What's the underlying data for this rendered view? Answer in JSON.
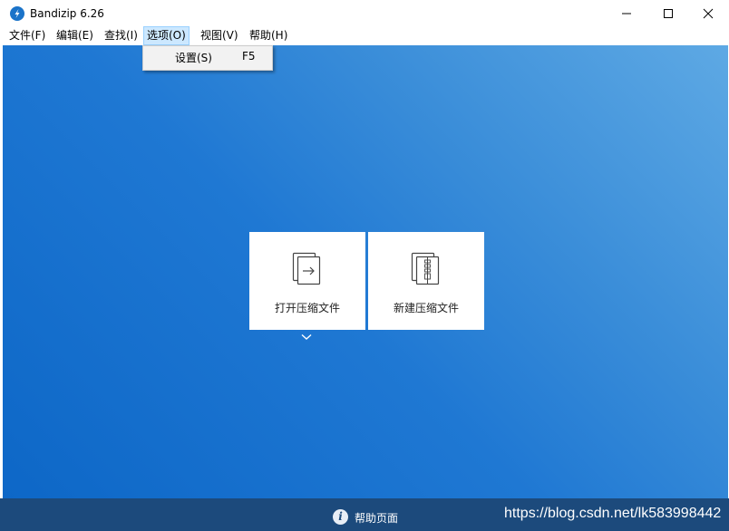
{
  "window": {
    "title": "Bandizip 6.26",
    "icon": "bandizip-logo-icon",
    "controls": [
      "minimize-icon",
      "maximize-icon",
      "close-icon"
    ]
  },
  "menubar": {
    "items": [
      {
        "label": "文件(F)"
      },
      {
        "label": "编辑(E)"
      },
      {
        "label": "查找(I)"
      },
      {
        "label": "选项(O)",
        "active": true
      },
      {
        "label": "视图(V)"
      },
      {
        "label": "帮助(H)"
      }
    ]
  },
  "dropdown": {
    "items": [
      {
        "label": "设置(S)",
        "shortcut": "F5"
      }
    ]
  },
  "actions": {
    "open_archive": {
      "label": "打开压缩文件",
      "icon": "open-archive-icon"
    },
    "new_archive": {
      "label": "新建压缩文件",
      "icon": "new-archive-icon"
    },
    "expand_icon": "chevron-down-icon"
  },
  "footer": {
    "help_label": "帮助页面",
    "help_icon": "info-icon",
    "watermark": "https://blog.csdn.net/lk583998442"
  },
  "colors": {
    "background_top_right": "#5ea9e4",
    "background_bottom_left": "#0d67c7",
    "footer": "#1c4a7c",
    "menu_highlight": "#cce8ff",
    "tile": "#ffffff"
  }
}
